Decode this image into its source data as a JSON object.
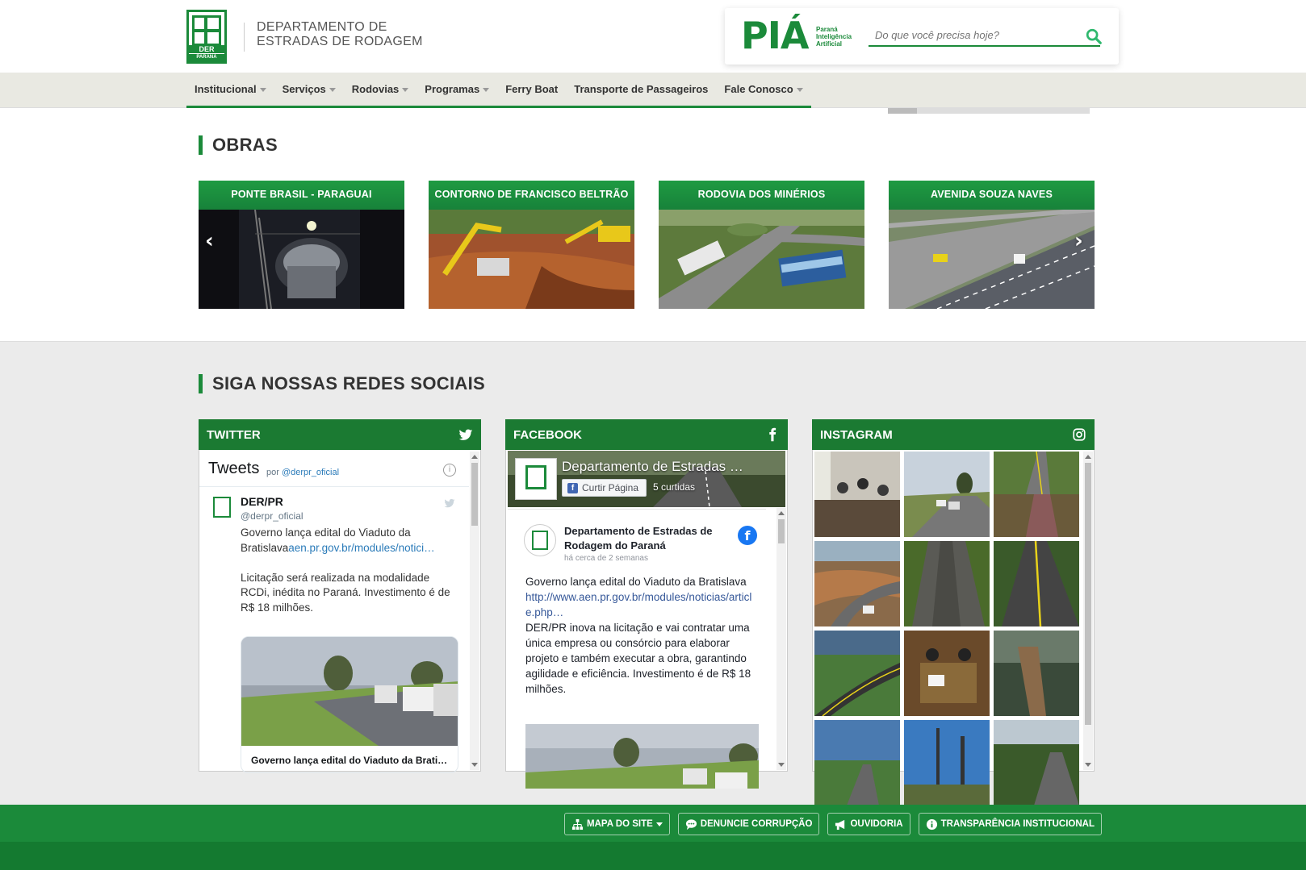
{
  "header": {
    "org_line1": "DEPARTAMENTO DE",
    "org_line2": "ESTRADAS DE RODAGEM",
    "logo_text": "DER",
    "logo_sub": "PARANÁ"
  },
  "pia": {
    "logo_text": "PIÁ",
    "sub_line1": "Paraná",
    "sub_line2": "Inteligência",
    "sub_line3": "Artificial",
    "search_placeholder": "Do que você precisa hoje?"
  },
  "nav": {
    "items": [
      {
        "label": "Institucional",
        "dropdown": true
      },
      {
        "label": "Serviços",
        "dropdown": true
      },
      {
        "label": "Rodovias",
        "dropdown": true
      },
      {
        "label": "Programas",
        "dropdown": true
      },
      {
        "label": "Ferry Boat",
        "dropdown": false
      },
      {
        "label": "Transporte de Passageiros",
        "dropdown": false
      },
      {
        "label": "Fale Conosco",
        "dropdown": true
      }
    ]
  },
  "obras": {
    "title": "OBRAS",
    "cards": [
      {
        "title": "PONTE BRASIL - PARAGUAI"
      },
      {
        "title": "CONTORNO DE FRANCISCO BELTRÃO"
      },
      {
        "title": "RODOVIA DOS MINÉRIOS"
      },
      {
        "title": "AVENIDA SOUZA NAVES"
      }
    ],
    "prev_arrow": "‹",
    "next_arrow": "›"
  },
  "social": {
    "title": "SIGA NOSSAS REDES SOCIAIS",
    "twitter": {
      "header": "TWITTER",
      "tweets_label": "Tweets",
      "por_label": "por",
      "handle_link": "@derpr_oficial",
      "author_name": "DER/PR",
      "author_handle": "@derpr_oficial",
      "text_part1": "Governo lança edital do Viaduto da Bratislava",
      "text_link": "aen.pr.gov.br/modules/notici…",
      "text_part2": "Licitação será realizada na modalidade RCDi, inédita no Paraná. Investimento é de R$ 18 milhões.",
      "card_title": "Governo lança edital do Viaduto da Brati…",
      "info_icon": "i"
    },
    "facebook": {
      "header": "FACEBOOK",
      "page_title": "Departamento de Estradas …",
      "like_button": "Curtir Página",
      "likes": "5 curtidas",
      "post_name": "Departamento de Estradas de Rodagem do Paraná",
      "post_time": "há cerca de 2 semanas",
      "post_text1": "Governo lança edital do Viaduto da Bratislava",
      "post_link": "http://www.aen.pr.gov.br/modules/noticias/article.php…",
      "post_text2": "DER/PR inova na licitação e vai contratar uma única empresa ou consórcio para elaborar projeto e também executar a obra, garantindo agilidade e eficiência. Investimento é de R$ 18 milhões."
    },
    "instagram": {
      "header": "INSTAGRAM"
    }
  },
  "footer": {
    "buttons": [
      {
        "label": "MAPA DO SITE",
        "icon": "sitemap-icon"
      },
      {
        "label": "DENUNCIE CORRUPÇÃO",
        "icon": "chat-icon"
      },
      {
        "label": "OUVIDORIA",
        "icon": "megaphone-icon"
      },
      {
        "label": "TRANSPARÊNCIA INSTITUCIONAL",
        "icon": "info-icon"
      }
    ]
  },
  "colors": {
    "brand_green": "#1b8a3a",
    "panel_header": "#1b7a32",
    "nav_bg": "#e9e9e2",
    "social_bg": "#ebebeb"
  }
}
